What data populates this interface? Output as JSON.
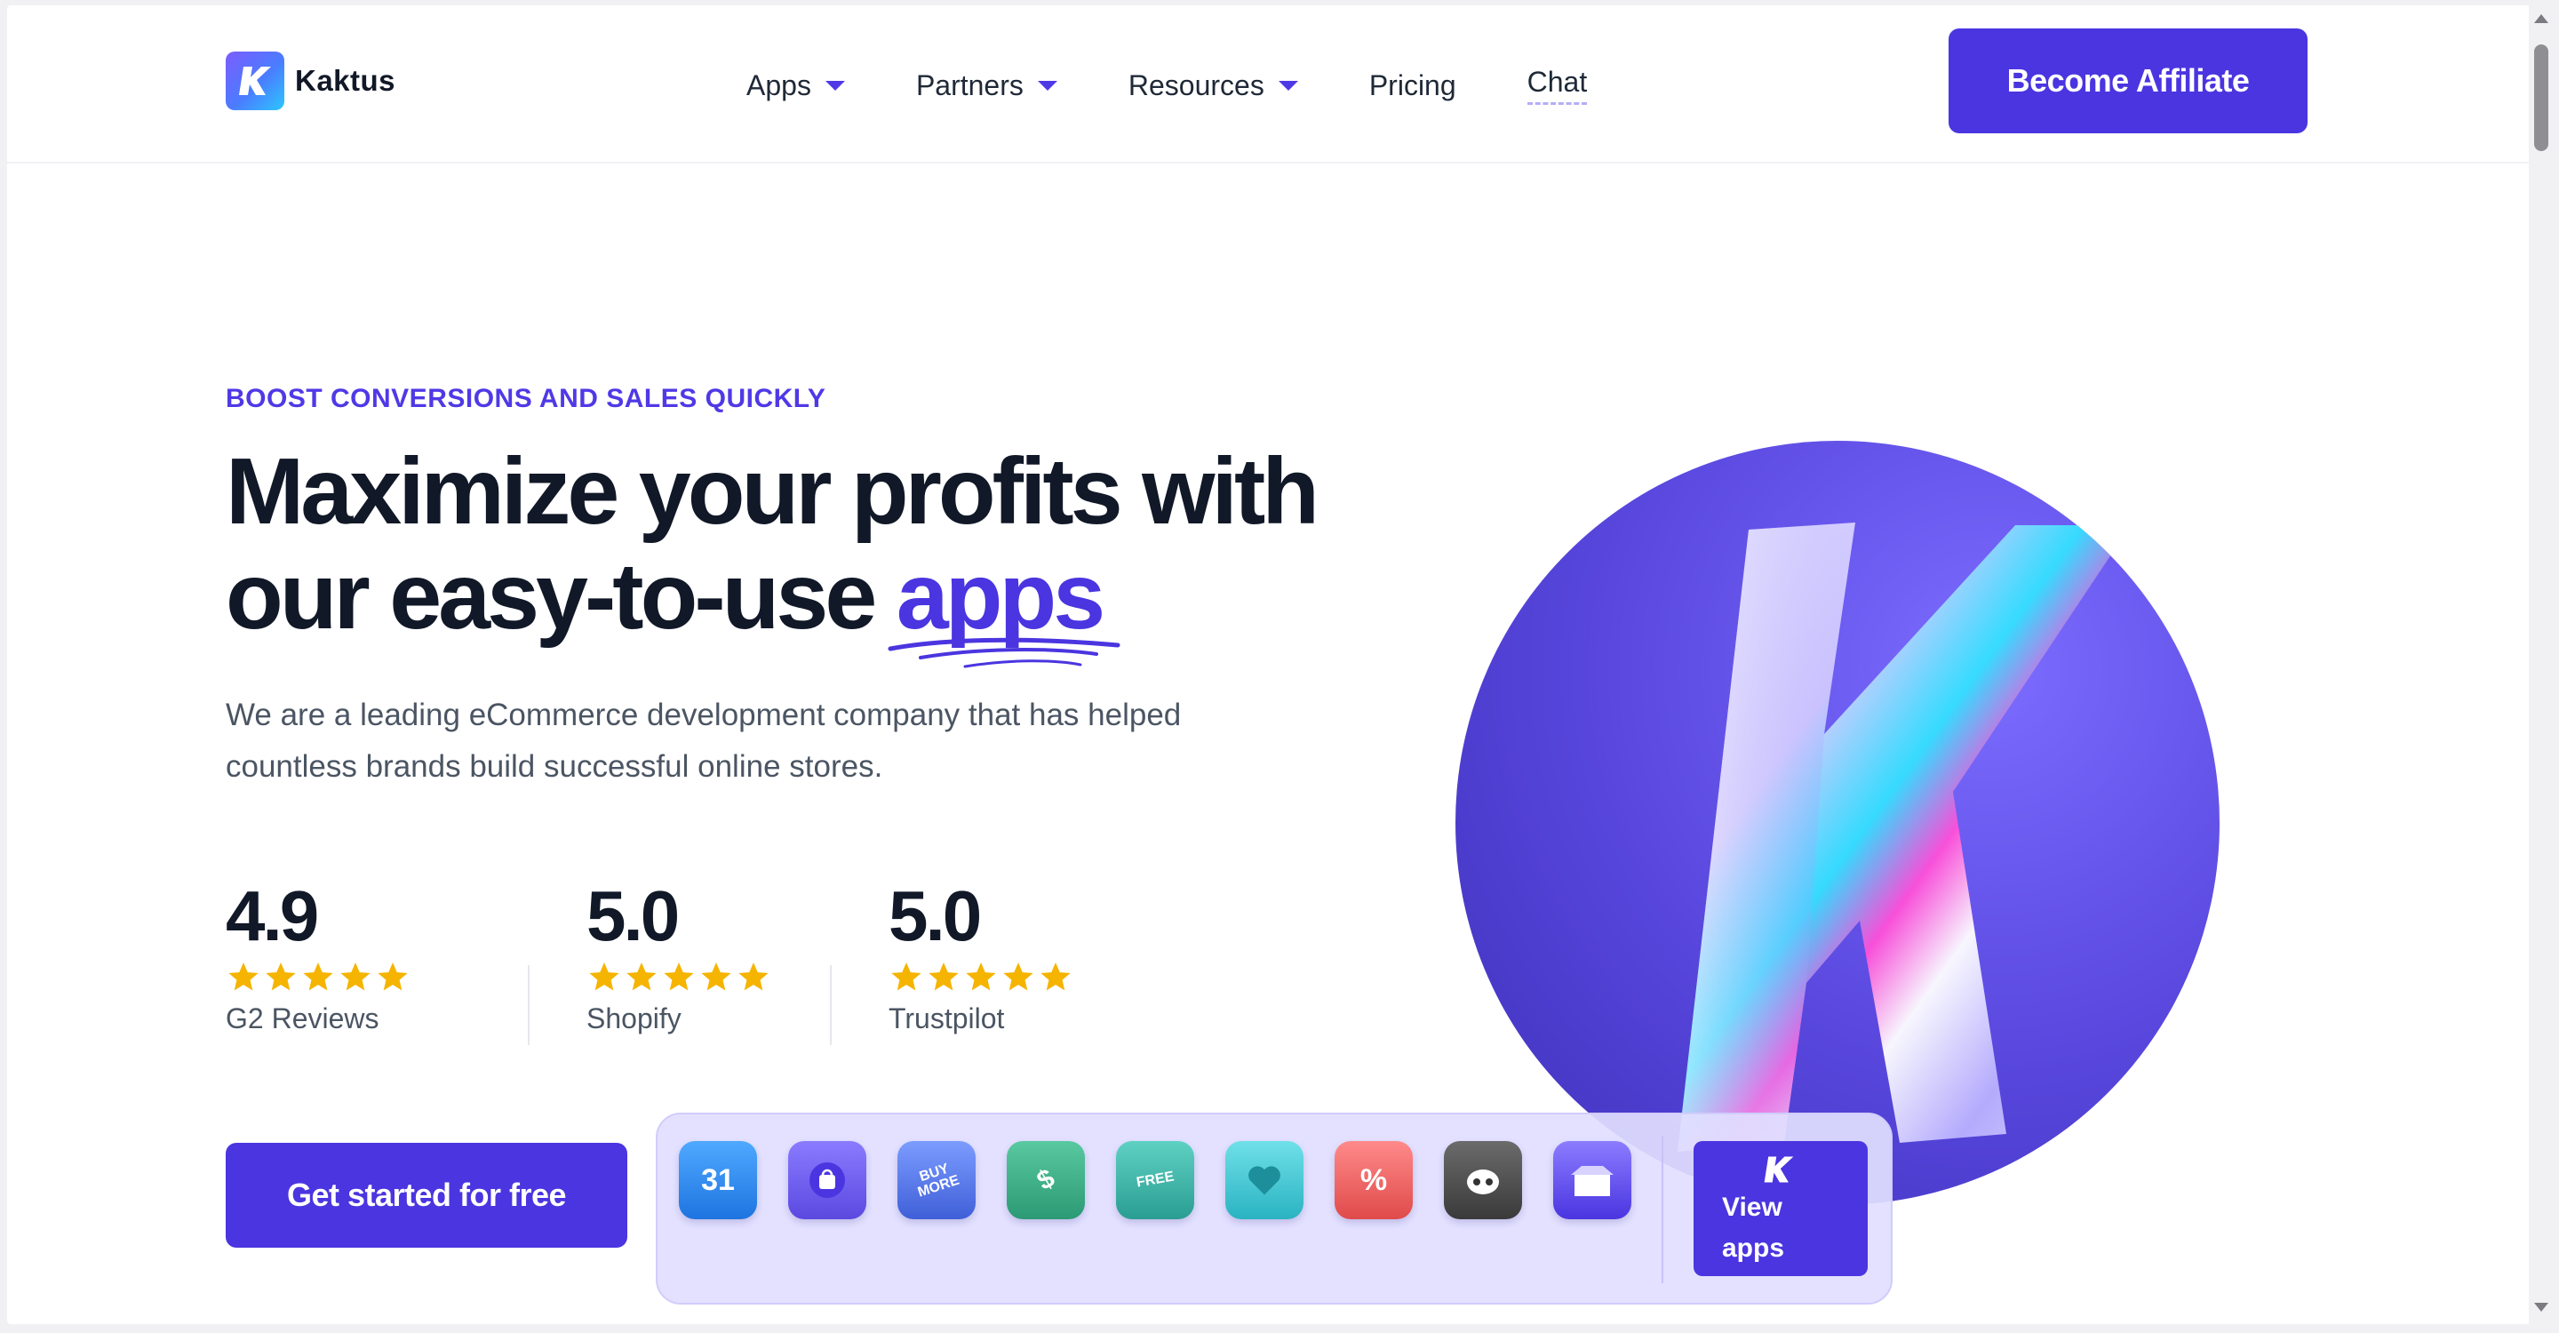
{
  "brand": {
    "name": "Kaktus",
    "logo_letter": "K"
  },
  "nav": {
    "items": [
      {
        "label": "Apps",
        "has_dropdown": true
      },
      {
        "label": "Partners",
        "has_dropdown": true
      },
      {
        "label": "Resources",
        "has_dropdown": true
      },
      {
        "label": "Pricing",
        "has_dropdown": false
      },
      {
        "label": "Chat",
        "has_dropdown": false
      }
    ],
    "cta": "Become Affiliate"
  },
  "hero": {
    "eyebrow": "BOOST CONVERSIONS AND SALES QUICKLY",
    "headline_line1": "Maximize your profits with",
    "headline_line2": "our easy-to-use ",
    "headline_accent": "apps",
    "lead": "We are a leading eCommerce development company that has helped countless brands build successful online stores.",
    "cta": "Get started for free"
  },
  "ratings": [
    {
      "score": "4.9",
      "stars": 5,
      "label": "G2 Reviews"
    },
    {
      "score": "5.0",
      "stars": 5,
      "label": "Shopify"
    },
    {
      "score": "5.0",
      "stars": 5,
      "label": "Trustpilot"
    }
  ],
  "app_tray": {
    "apps": [
      {
        "icon": "calendar-icon",
        "text": "31"
      },
      {
        "icon": "shopping-bag-badge-icon",
        "text": ""
      },
      {
        "icon": "buy-more-badge-icon",
        "text": "BUY MORE"
      },
      {
        "icon": "price-tag-icon",
        "text": "$"
      },
      {
        "icon": "free-shipping-truck-icon",
        "text": "FREE"
      },
      {
        "icon": "heart-badge-icon",
        "text": ""
      },
      {
        "icon": "percent-badge-icon",
        "text": "%"
      },
      {
        "icon": "robot-face-icon",
        "text": ""
      },
      {
        "icon": "open-box-icon",
        "text": ""
      }
    ],
    "view_line1": "View",
    "view_line2": "apps"
  },
  "colors": {
    "accent": "#4a35e0",
    "star": "#f5b400",
    "text_dark": "#111827",
    "text_muted": "#4b5563"
  }
}
